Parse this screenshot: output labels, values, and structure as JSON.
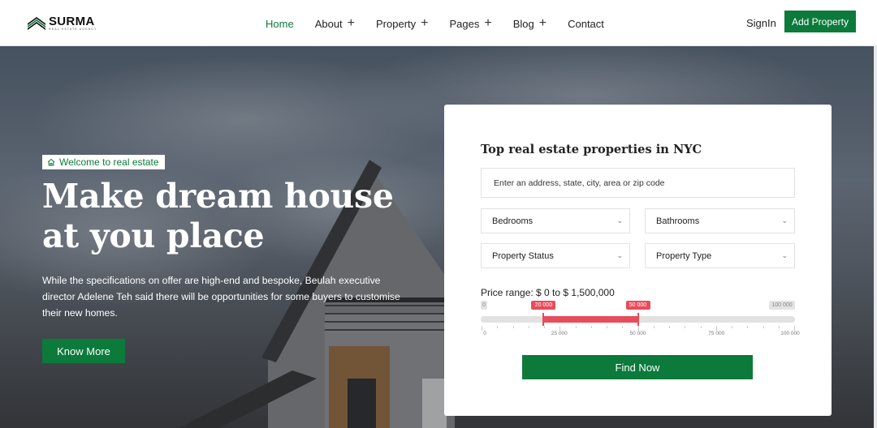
{
  "brand": {
    "name": "SURMA",
    "tagline": "REAL ESTATE AGENCY"
  },
  "nav": {
    "items": [
      {
        "label": "Home",
        "active": true,
        "has_submenu": false
      },
      {
        "label": "About",
        "active": false,
        "has_submenu": true
      },
      {
        "label": "Property",
        "active": false,
        "has_submenu": true
      },
      {
        "label": "Pages",
        "active": false,
        "has_submenu": true
      },
      {
        "label": "Blog",
        "active": false,
        "has_submenu": true
      },
      {
        "label": "Contact",
        "active": false,
        "has_submenu": false
      }
    ],
    "submenu_glyph": "+"
  },
  "header": {
    "signin_label": "SignIn",
    "add_property_label": "Add Property"
  },
  "hero": {
    "badge_icon": "home-icon",
    "badge_text": "Welcome to real estate",
    "title": "Make dream house at you place",
    "description": "While the specifications on offer are high-end and bespoke, Beulah executive director Adelene Teh said there will be opportunities for some buyers to customise their new homes.",
    "cta_label": "Know More"
  },
  "search": {
    "title": "Top real estate properties in NYC",
    "address_placeholder": "Enter an address, state, city, area or zip code",
    "bedrooms_label": "Bedrooms",
    "bathrooms_label": "Bathrooms",
    "status_label": "Property Status",
    "type_label": "Property Type",
    "price_range_label": "Price range: $ 0 to $ 1,500,000",
    "range": {
      "min": 0,
      "max": 100000,
      "from": 20000,
      "to": 50000,
      "min_label": "0",
      "max_label": "100 000",
      "from_label": "20 000",
      "to_label": "50 000",
      "ticks": [
        {
          "value": 0,
          "label": "0"
        },
        {
          "value": 25000,
          "label": "25 000"
        },
        {
          "value": 50000,
          "label": "50 000"
        },
        {
          "value": 75000,
          "label": "75 000"
        },
        {
          "value": 100000,
          "label": "100 000"
        }
      ]
    },
    "submit_label": "Find Now"
  },
  "colors": {
    "accent": "#0b7a3b",
    "range_accent": "#e74d5a"
  }
}
